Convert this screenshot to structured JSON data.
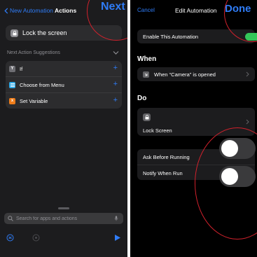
{
  "left_screen": {
    "nav": {
      "back_label": "New Automation",
      "title": "Actions",
      "next_label": "Next"
    },
    "selected_action": {
      "label": "Lock the screen",
      "icon": "lock-icon"
    },
    "suggestions": {
      "header": "Next Action Suggestions",
      "items": [
        {
          "label": "If",
          "icon": "if-icon",
          "color": "#6e6e73"
        },
        {
          "label": "Choose from Menu",
          "icon": "menu-icon",
          "color": "#30a9e6"
        },
        {
          "label": "Set Variable",
          "icon": "variable-icon",
          "color": "#ef7d1a"
        }
      ]
    },
    "search": {
      "placeholder": "Search for apps and actions"
    }
  },
  "right_screen": {
    "nav": {
      "cancel_label": "Cancel",
      "title": "Edit Automation",
      "done_label": "Done"
    },
    "enable_label": "Enable This Automation",
    "when": {
      "header": "When",
      "trigger_label": "When “Camera” is opened"
    },
    "do": {
      "header": "Do",
      "action_label": "Lock Screen"
    },
    "options": [
      {
        "label": "Ask Before Running",
        "enabled": false
      },
      {
        "label": "Notify When Run",
        "enabled": false
      }
    ]
  },
  "colors": {
    "accent": "#2f7cf6",
    "annotation": "#d0212c",
    "toggle_on": "#34c759"
  }
}
